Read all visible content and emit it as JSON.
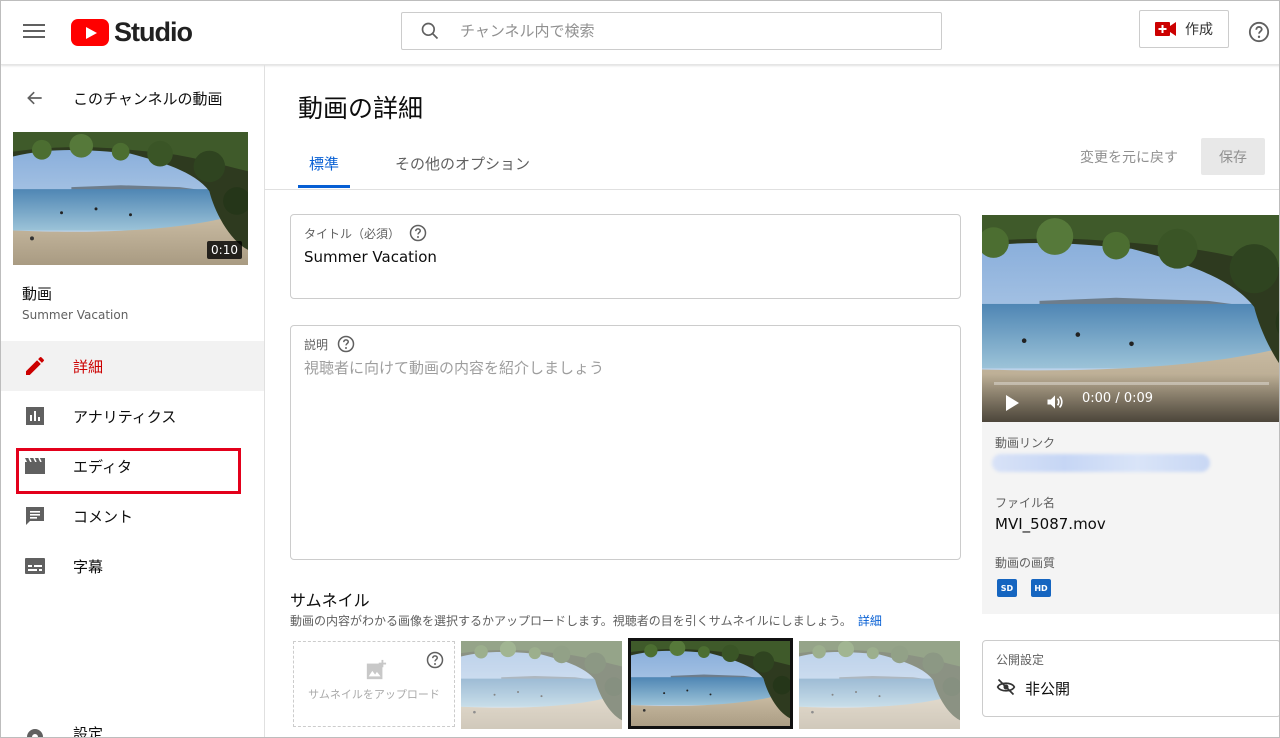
{
  "header": {
    "logo_text": "Studio",
    "search_placeholder": "チャンネル内で検索",
    "create_label": "作成"
  },
  "sidebar": {
    "back_label": "このチャンネルの動画",
    "thumbnail_duration": "0:10",
    "video_label": "動画",
    "video_title": "Summer Vacation",
    "items": [
      {
        "label": "詳細",
        "icon": "pencil-icon",
        "active": true
      },
      {
        "label": "アナリティクス",
        "icon": "analytics-icon",
        "active": false
      },
      {
        "label": "エディタ",
        "icon": "clapperboard-icon",
        "active": false
      },
      {
        "label": "コメント",
        "icon": "comment-icon",
        "active": false
      },
      {
        "label": "字幕",
        "icon": "subtitles-icon",
        "active": false
      }
    ],
    "settings_label": "設定"
  },
  "main": {
    "page_title": "動画の詳細",
    "tabs": [
      {
        "label": "標準"
      },
      {
        "label": "その他のオプション"
      }
    ],
    "revert_label": "変更を元に戻す",
    "save_label": "保存",
    "title_field": {
      "label": "タイトル（必須）",
      "value": "Summer Vacation"
    },
    "description_field": {
      "label": "説明",
      "placeholder": "視聴者に向けて動画の内容を紹介しましょう"
    },
    "thumbnail": {
      "heading": "サムネイル",
      "description": "動画の内容がわかる画像を選択するかアップロードします。視聴者の目を引くサムネイルにしましょう。",
      "details_link": "詳細",
      "upload_label": "サムネイルをアップロード"
    }
  },
  "right_panel": {
    "time_display": "0:00 / 0:09",
    "video_link_label": "動画リンク",
    "file_name_label": "ファイル名",
    "file_name": "MVI_5087.mov",
    "quality_label": "動画の画質",
    "quality_badges": [
      "SD",
      "HD"
    ],
    "visibility_label": "公開設定",
    "visibility_value": "非公開"
  },
  "colors": {
    "accent_blue": "#065fd4",
    "active_red": "#cc0000",
    "highlight_red": "#e3001b",
    "youtube_red": "#ff0000"
  }
}
